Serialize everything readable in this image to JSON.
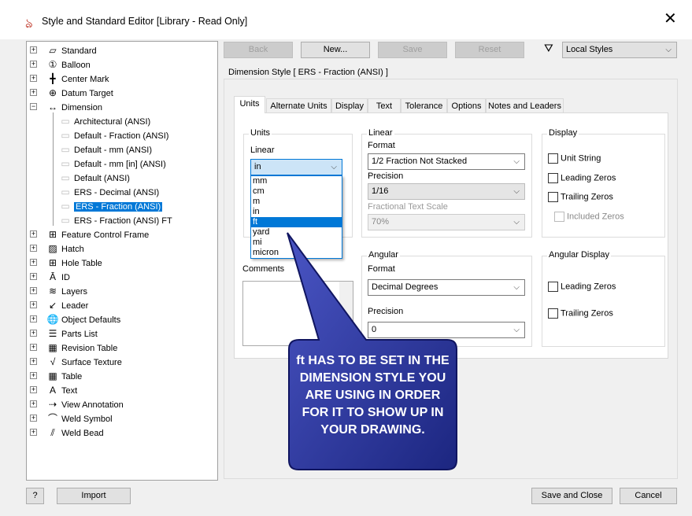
{
  "window": {
    "title": "Style and Standard Editor [Library - Read Only]",
    "close": "✕"
  },
  "tree": [
    {
      "label": "Standard",
      "icon": "standard-icon",
      "glyph": "▱"
    },
    {
      "label": "Balloon",
      "icon": "balloon-icon",
      "glyph": "①"
    },
    {
      "label": "Center Mark",
      "icon": "center-mark-icon",
      "glyph": "╋"
    },
    {
      "label": "Datum Target",
      "icon": "datum-target-icon",
      "glyph": "⊕"
    },
    {
      "label": "Dimension",
      "icon": "dimension-icon",
      "glyph": "↔"
    }
  ],
  "dimension_children": [
    "Architectural (ANSI)",
    "Default - Fraction (ANSI)",
    "Default - mm (ANSI)",
    "Default - mm [in] (ANSI)",
    "Default (ANSI)",
    "ERS - Decimal (ANSI)",
    "ERS - Fraction (ANSI)",
    "ERS - Fraction (ANSI) FT"
  ],
  "tree_rest": [
    {
      "label": "Feature Control Frame",
      "icon": "feature-control-frame-icon",
      "glyph": "⊞"
    },
    {
      "label": "Hatch",
      "icon": "hatch-icon",
      "glyph": "▨"
    },
    {
      "label": "Hole Table",
      "icon": "hole-table-icon",
      "glyph": "⊞"
    },
    {
      "label": "ID",
      "icon": "id-icon",
      "glyph": "Ā"
    },
    {
      "label": "Layers",
      "icon": "layers-icon",
      "glyph": "≋"
    },
    {
      "label": "Leader",
      "icon": "leader-icon",
      "glyph": "↙"
    },
    {
      "label": "Object Defaults",
      "icon": "object-defaults-icon",
      "glyph": "🌐"
    },
    {
      "label": "Parts List",
      "icon": "parts-list-icon",
      "glyph": "☰"
    },
    {
      "label": "Revision Table",
      "icon": "revision-table-icon",
      "glyph": "▦"
    },
    {
      "label": "Surface Texture",
      "icon": "surface-texture-icon",
      "glyph": "√"
    },
    {
      "label": "Table",
      "icon": "table-icon",
      "glyph": "▦"
    },
    {
      "label": "Text",
      "icon": "text-icon",
      "glyph": "A"
    },
    {
      "label": "View Annotation",
      "icon": "view-annotation-icon",
      "glyph": "⇢"
    },
    {
      "label": "Weld Symbol",
      "icon": "weld-symbol-icon",
      "glyph": "⌒"
    },
    {
      "label": "Weld Bead",
      "icon": "weld-bead-icon",
      "glyph": "⫽"
    }
  ],
  "toolbar": {
    "back": "Back",
    "new": "New...",
    "save": "Save",
    "reset": "Reset",
    "filter_value": "Local Styles"
  },
  "style_header": "Dimension Style [ ERS - Fraction (ANSI) ]",
  "tabs": [
    "Units",
    "Alternate Units",
    "Display",
    "Text",
    "Tolerance",
    "Options",
    "Notes and Leaders"
  ],
  "units": {
    "group": "Units",
    "linear_label": "Linear",
    "linear_value": "in",
    "options": [
      "mm",
      "cm",
      "m",
      "in",
      "ft",
      "yard",
      "mi",
      "micron"
    ],
    "highlighted": "ft"
  },
  "comments_label": "Comments",
  "linear": {
    "group": "Linear",
    "format_label": "Format",
    "format_value": "1/2 Fraction Not Stacked",
    "precision_label": "Precision",
    "precision_value": "1/16",
    "fts_label": "Fractional Text Scale",
    "fts_value": "70%"
  },
  "display": {
    "group": "Display",
    "unit_string": "Unit String",
    "leading": "Leading Zeros",
    "trailing": "Trailing Zeros",
    "included": "Included Zeros"
  },
  "angular": {
    "group": "Angular",
    "format_label": "Format",
    "format_value": "Decimal Degrees",
    "precision_label": "Precision",
    "precision_value": "0"
  },
  "angular_display": {
    "group": "Angular Display",
    "leading": "Leading Zeros",
    "trailing": "Trailing Zeros"
  },
  "footer": {
    "help": "?",
    "import": "Import",
    "save_close": "Save and Close",
    "cancel": "Cancel"
  },
  "callout": {
    "text": "ft HAS TO BE SET IN THE DIMENSION STYLE YOU ARE USING IN ORDER FOR IT TO SHOW UP IN YOUR DRAWING.",
    "color": "#1f2a8a"
  }
}
